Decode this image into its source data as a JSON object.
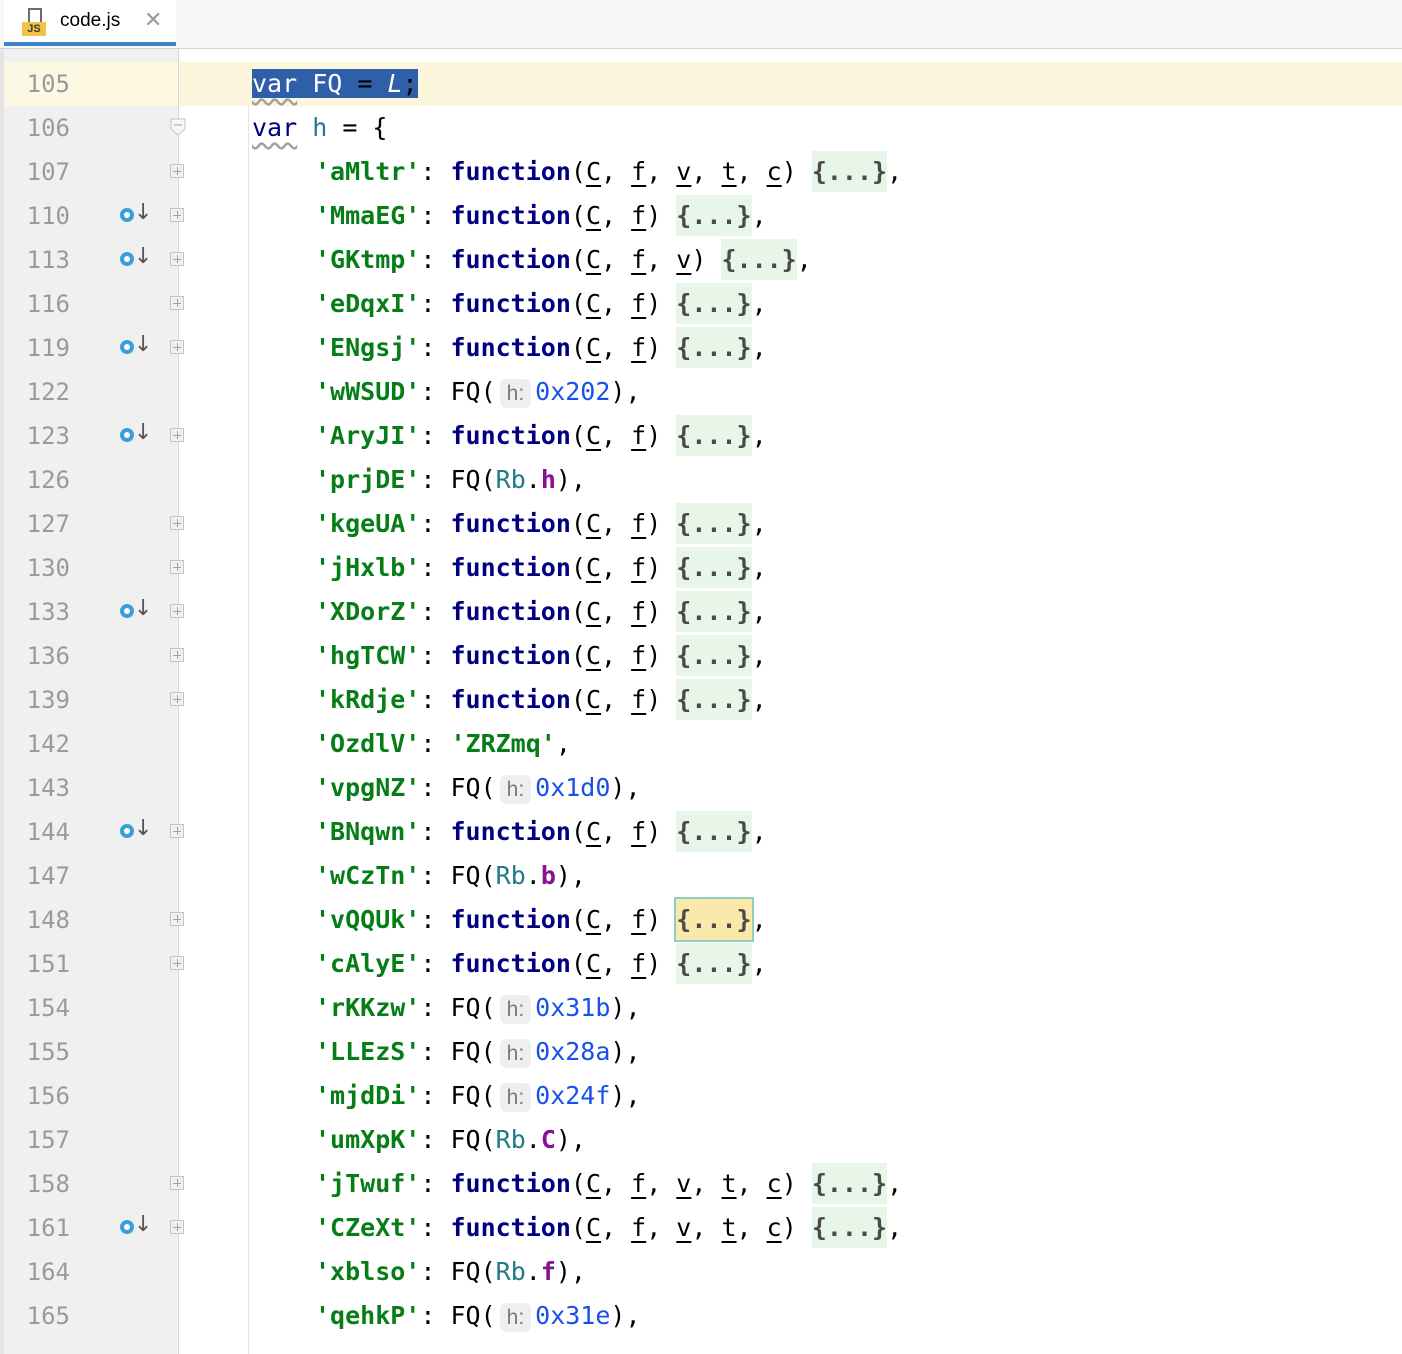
{
  "tab": {
    "file_badge": "JS",
    "title": "code.js",
    "close_glyph": "✕"
  },
  "editor": {
    "selected_line": "105",
    "lines": [
      {
        "n": "105",
        "kind": "decl_sel"
      },
      {
        "n": "106",
        "kind": "decl_obj"
      },
      {
        "n": "107",
        "kind": "func",
        "key": "'aMltr'",
        "params": [
          "C",
          "f",
          "v",
          "t",
          "c"
        ],
        "bp": false
      },
      {
        "n": "110",
        "kind": "func",
        "key": "'MmaEG'",
        "params": [
          "C",
          "f"
        ],
        "bp": true
      },
      {
        "n": "113",
        "kind": "func",
        "key": "'GKtmp'",
        "params": [
          "C",
          "f",
          "v"
        ],
        "bp": true
      },
      {
        "n": "116",
        "kind": "func",
        "key": "'eDqxI'",
        "params": [
          "C",
          "f"
        ],
        "bp": false
      },
      {
        "n": "119",
        "kind": "func",
        "key": "'ENgsj'",
        "params": [
          "C",
          "f"
        ],
        "bp": true
      },
      {
        "n": "122",
        "kind": "fqhex",
        "key": "'wWSUD'",
        "hint": "h:",
        "hex": "0x202"
      },
      {
        "n": "123",
        "kind": "func",
        "key": "'AryJI'",
        "params": [
          "C",
          "f"
        ],
        "bp": true
      },
      {
        "n": "126",
        "kind": "fqprop",
        "key": "'prjDE'",
        "obj": "Rb",
        "prop": "h"
      },
      {
        "n": "127",
        "kind": "func",
        "key": "'kgeUA'",
        "params": [
          "C",
          "f"
        ],
        "bp": false
      },
      {
        "n": "130",
        "kind": "func",
        "key": "'jHxlb'",
        "params": [
          "C",
          "f"
        ],
        "bp": false
      },
      {
        "n": "133",
        "kind": "func",
        "key": "'XDorZ'",
        "params": [
          "C",
          "f"
        ],
        "bp": true
      },
      {
        "n": "136",
        "kind": "func",
        "key": "'hgTCW'",
        "params": [
          "C",
          "f"
        ],
        "bp": false
      },
      {
        "n": "139",
        "kind": "func",
        "key": "'kRdje'",
        "params": [
          "C",
          "f"
        ],
        "bp": false
      },
      {
        "n": "142",
        "kind": "strval",
        "key": "'OzdlV'",
        "val": "'ZRZmq'"
      },
      {
        "n": "143",
        "kind": "fqhex",
        "key": "'vpgNZ'",
        "hint": "h:",
        "hex": "0x1d0"
      },
      {
        "n": "144",
        "kind": "func",
        "key": "'BNqwn'",
        "params": [
          "C",
          "f"
        ],
        "bp": true
      },
      {
        "n": "147",
        "kind": "fqprop",
        "key": "'wCzTn'",
        "obj": "Rb",
        "prop": "b"
      },
      {
        "n": "148",
        "kind": "func",
        "key": "'vQQUk'",
        "params": [
          "C",
          "f"
        ],
        "bp": false,
        "hl": true
      },
      {
        "n": "151",
        "kind": "func",
        "key": "'cAlyE'",
        "params": [
          "C",
          "f"
        ],
        "bp": false
      },
      {
        "n": "154",
        "kind": "fqhex",
        "key": "'rKKzw'",
        "hint": "h:",
        "hex": "0x31b"
      },
      {
        "n": "155",
        "kind": "fqhex",
        "key": "'LLEzS'",
        "hint": "h:",
        "hex": "0x28a"
      },
      {
        "n": "156",
        "kind": "fqhex",
        "key": "'mjdDi'",
        "hint": "h:",
        "hex": "0x24f"
      },
      {
        "n": "157",
        "kind": "fqprop",
        "key": "'umXpK'",
        "obj": "Rb",
        "prop": "C"
      },
      {
        "n": "158",
        "kind": "func",
        "key": "'jTwuf'",
        "params": [
          "C",
          "f",
          "v",
          "t",
          "c"
        ],
        "bp": false
      },
      {
        "n": "161",
        "kind": "func",
        "key": "'CZeXt'",
        "params": [
          "C",
          "f",
          "v",
          "t",
          "c"
        ],
        "bp": true
      },
      {
        "n": "164",
        "kind": "fqprop",
        "key": "'xblso'",
        "obj": "Rb",
        "prop": "f"
      },
      {
        "n": "165",
        "kind": "fqhex",
        "key": "'qehkP'",
        "hint": "h:",
        "hex": "0x31e"
      }
    ],
    "tokens": {
      "var": "var",
      "fq": "FQ",
      "l": "L",
      "h": "h",
      "function": "function",
      "fold": "{...}",
      "eq": " = ",
      "semicolon": ";",
      "open_brace": "{"
    }
  },
  "colors": {
    "keyword": "#000080",
    "string": "#067d17",
    "number": "#1750eb",
    "property": "#871094",
    "selection": "#2f5fa8",
    "current_line": "#fcf6dc",
    "fold_bg": "#e8f5e9",
    "breakpoint": "#3aa0d8"
  },
  "icons": {
    "tab_file": "js-file-icon",
    "breakpoint": "breakpoint-arrow-icon",
    "fold": "fold-plus-icon",
    "fold_open": "fold-open-icon"
  }
}
